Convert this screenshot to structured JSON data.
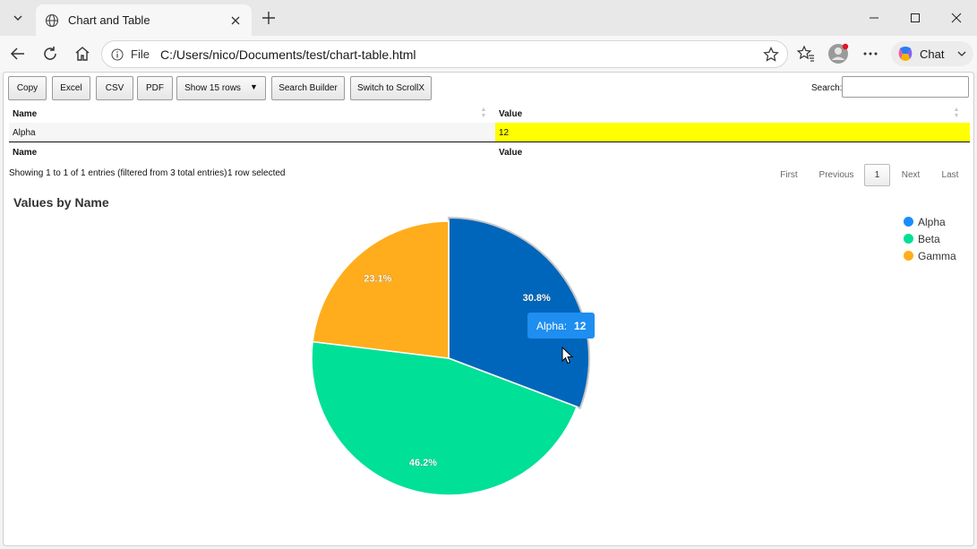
{
  "browser": {
    "tab_title": "Chart and Table",
    "address_prefix": "File",
    "address_url": "C:/Users/nico/Documents/test/chart-table.html",
    "chat_label": "Chat"
  },
  "toolbar_buttons": {
    "copy": "Copy",
    "excel": "Excel",
    "csv": "CSV",
    "pdf": "PDF",
    "show_rows": "Show 15 rows",
    "search_builder": "Search Builder",
    "switch_scroll": "Switch to ScrollX"
  },
  "search": {
    "label": "Search:",
    "value": ""
  },
  "table": {
    "columns": [
      "Name",
      "Value"
    ],
    "rows": [
      {
        "name": "Alpha",
        "value": "12"
      }
    ],
    "highlight_color": "#ffff00"
  },
  "table_info": "Showing 1 to 1 of 1 entries (filtered from 3 total entries)",
  "selection_info": "1 row selected",
  "pagination": {
    "first": "First",
    "previous": "Previous",
    "current": "1",
    "next": "Next",
    "last": "Last"
  },
  "chart_data": {
    "type": "pie",
    "title": "Values by Name",
    "categories": [
      "Alpha",
      "Beta",
      "Gamma"
    ],
    "values": [
      12,
      18,
      9
    ],
    "data_labels": [
      "30.8%",
      "46.2%",
      "23.1%"
    ],
    "colors": [
      "#0066bb",
      "#00e096",
      "#ffad1c"
    ],
    "legend_colors": [
      "#1a8cff",
      "#00e096",
      "#ffad1c"
    ],
    "legend_position": "top-right",
    "selected_slice": "Alpha",
    "tooltip": {
      "label": "Alpha:",
      "value": "12"
    }
  }
}
